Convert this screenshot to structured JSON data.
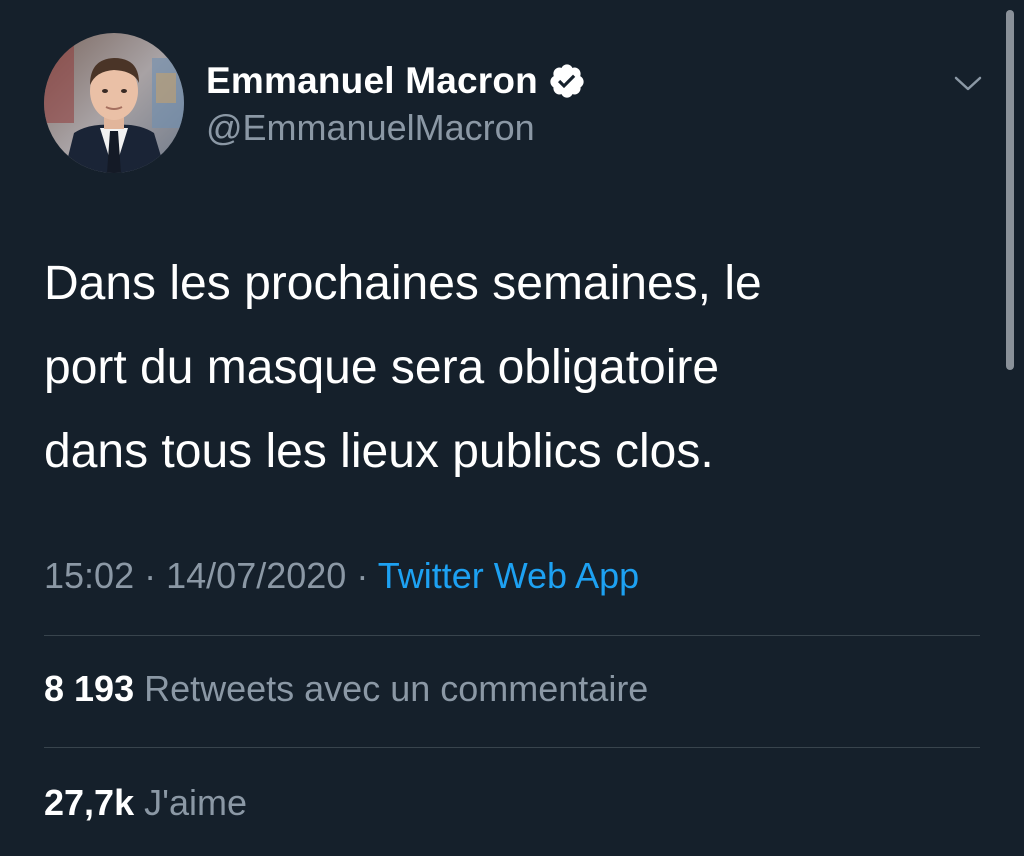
{
  "tweet": {
    "author": {
      "display_name": "Emmanuel Macron",
      "handle": "@EmmanuelMacron",
      "verified": true,
      "avatar_icon": "profile-photo"
    },
    "text_lines": [
      "Dans les prochaines semaines, le",
      "port du masque sera obligatoire",
      "dans tous les lieux publics clos."
    ],
    "time": "15:02",
    "separator": "·",
    "date": "14/07/2020",
    "source": "Twitter Web App",
    "stats": {
      "retweets_count": "8 193",
      "retweets_label": "Retweets avec un commentaire",
      "likes_count": "27,7k",
      "likes_label": "J'aime"
    }
  },
  "colors": {
    "background": "#15202b",
    "text_primary": "#ffffff",
    "text_secondary": "#8b98a5",
    "link": "#1da1f2",
    "divider": "#38444d"
  }
}
